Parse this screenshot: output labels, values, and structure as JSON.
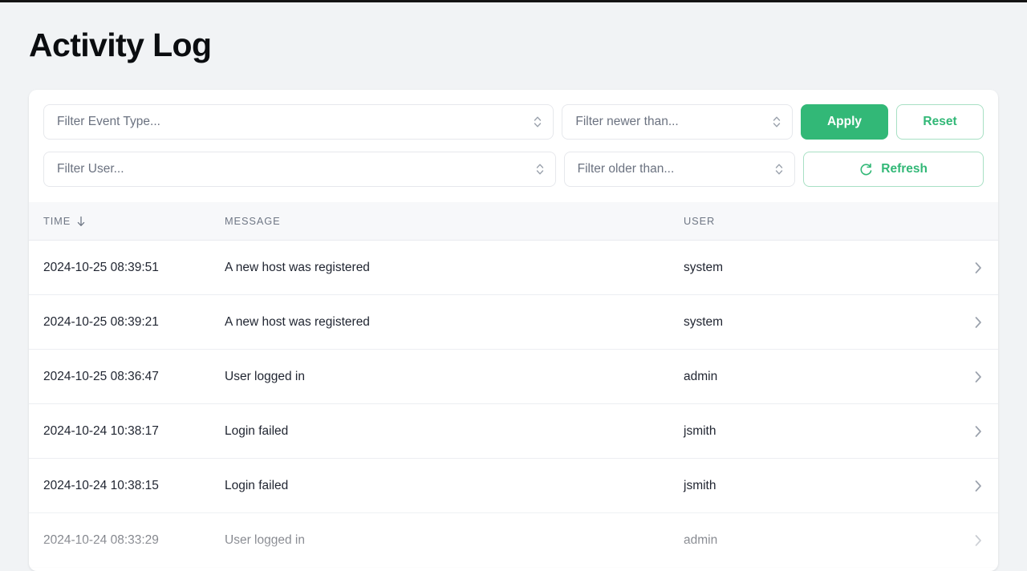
{
  "page": {
    "title": "Activity Log"
  },
  "filters": {
    "event_type": {
      "placeholder": "Filter Event Type...",
      "value": ""
    },
    "user": {
      "placeholder": "Filter User...",
      "value": ""
    },
    "newer_than": {
      "placeholder": "Filter newer than...",
      "value": ""
    },
    "older_than": {
      "placeholder": "Filter older than...",
      "value": ""
    },
    "apply_label": "Apply",
    "reset_label": "Reset",
    "refresh_label": "Refresh"
  },
  "table": {
    "columns": [
      "TIME",
      "MESSAGE",
      "USER"
    ],
    "sort": {
      "column": "TIME",
      "direction": "descending"
    },
    "rows": [
      {
        "time": "2024-10-25 08:39:51",
        "message": "A new host was registered",
        "user": "system"
      },
      {
        "time": "2024-10-25 08:39:21",
        "message": "A new host was registered",
        "user": "system"
      },
      {
        "time": "2024-10-25 08:36:47",
        "message": "User logged in",
        "user": "admin"
      },
      {
        "time": "2024-10-24 10:38:17",
        "message": "Login failed",
        "user": "jsmith"
      },
      {
        "time": "2024-10-24 10:38:15",
        "message": "Login failed",
        "user": "jsmith"
      },
      {
        "time": "2024-10-24 08:33:29",
        "message": "User logged in",
        "user": "admin"
      }
    ]
  },
  "colors": {
    "accent": "#32b877",
    "accent_border": "#a8e0c4",
    "page_bg": "#f1f3f5",
    "card_bg": "#ffffff",
    "header_bg": "#f7f8fa",
    "muted_text": "#6b7280"
  }
}
